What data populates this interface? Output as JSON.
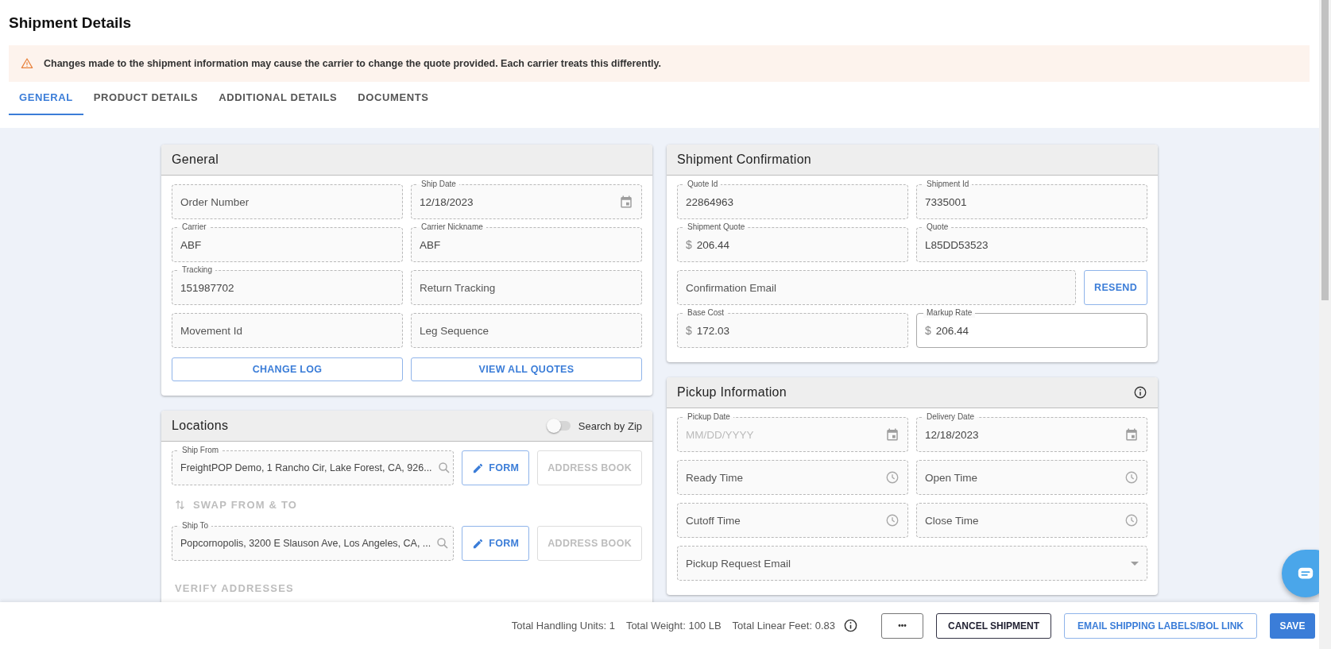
{
  "page": {
    "title": "Shipment Details"
  },
  "alert": {
    "text": "Changes made to the shipment information may cause the carrier to change the quote provided. Each carrier treats this differently."
  },
  "tabs": [
    {
      "label": "GENERAL",
      "selected": true
    },
    {
      "label": "PRODUCT DETAILS",
      "selected": false
    },
    {
      "label": "ADDITIONAL DETAILS",
      "selected": false
    },
    {
      "label": "DOCUMENTS",
      "selected": false
    }
  ],
  "general": {
    "title": "General",
    "rows": [
      [
        {
          "kind": "field",
          "placeholder": "Order Number",
          "disabled": true
        },
        {
          "kind": "date",
          "label": "Ship Date",
          "value": "12/18/2023",
          "disabled": true
        }
      ],
      [
        {
          "kind": "field",
          "label": "Carrier",
          "value": "ABF",
          "disabled": true
        },
        {
          "kind": "field",
          "label": "Carrier Nickname",
          "value": "ABF",
          "disabled": true
        }
      ],
      [
        {
          "kind": "field",
          "label": "Tracking",
          "value": " 151987702",
          "disabled": true
        },
        {
          "kind": "field",
          "placeholder": "Return Tracking",
          "disabled": true
        }
      ],
      [
        {
          "kind": "field",
          "placeholder": "Movement Id",
          "disabled": true
        },
        {
          "kind": "field",
          "placeholder": "Leg Sequence",
          "disabled": true
        }
      ],
      [
        {
          "kind": "button",
          "label": "CHANGE LOG",
          "disabled": false
        },
        {
          "kind": "button",
          "label": "VIEW ALL QUOTES",
          "disabled": false
        }
      ]
    ]
  },
  "locations": {
    "title": "Locations",
    "search_by_zip": {
      "label": "Search by Zip",
      "on": false
    },
    "rows": [
      [
        {
          "kind": "search",
          "label": "Ship From",
          "value": "FreightPOP Demo, 1 Rancho Cir, Lake Forest, CA, 926...",
          "disabled": true
        },
        {
          "kind": "edit_button",
          "label": "FORM",
          "disabled": false
        },
        {
          "kind": "button",
          "label": "ADDRESS BOOK",
          "disabled": true
        }
      ],
      [
        {
          "kind": "swap_link",
          "label": "SWAP FROM & TO",
          "disabled": true
        }
      ],
      [
        {
          "kind": "search",
          "label": "Ship To",
          "value": "Popcornopolis, 3200 E Slauson Ave, Los Angeles, CA, ...",
          "disabled": true
        },
        {
          "kind": "edit_button",
          "label": "FORM",
          "disabled": false
        },
        {
          "kind": "button",
          "label": "ADDRESS BOOK",
          "disabled": true
        }
      ],
      [
        {
          "kind": "link",
          "label": "VERIFY ADDRESSES",
          "disabled": true
        }
      ]
    ]
  },
  "confirmation": {
    "title": "Shipment Confirmation",
    "rows": [
      [
        {
          "kind": "field",
          "label": "Quote Id",
          "value": "22864963",
          "disabled": true
        },
        {
          "kind": "field",
          "label": "Shipment Id",
          "value": "7335001",
          "disabled": true
        }
      ],
      [
        {
          "kind": "field",
          "label": "Shipment Quote",
          "prefix": "$",
          "value": "206.44",
          "disabled": true
        },
        {
          "kind": "field",
          "label": "Quote",
          "value": "L85DD53523",
          "disabled": true
        }
      ],
      [
        {
          "kind": "field",
          "placeholder": "Confirmation Email",
          "disabled": true
        },
        {
          "kind": "button",
          "label": "RESEND",
          "disabled": false
        }
      ],
      [
        {
          "kind": "field",
          "label": "Base Cost",
          "prefix": "$",
          "value": "172.03",
          "disabled": true
        },
        {
          "kind": "field",
          "label": "Markup Rate",
          "prefix": "$",
          "value": "206.44",
          "disabled": false
        }
      ]
    ]
  },
  "pickup": {
    "title": "Pickup Information",
    "rows": [
      [
        {
          "kind": "date",
          "label": "Pickup Date",
          "placeholder": "MM/DD/YYYY",
          "disabled": true
        },
        {
          "kind": "date",
          "label": "Delivery Date",
          "value": "12/18/2023",
          "disabled": true
        }
      ],
      [
        {
          "kind": "time",
          "placeholder": "Ready Time",
          "disabled": true
        },
        {
          "kind": "time",
          "placeholder": "Open Time",
          "disabled": true
        }
      ],
      [
        {
          "kind": "time",
          "placeholder": "Cutoff Time",
          "disabled": true
        },
        {
          "kind": "time",
          "placeholder": "Close Time",
          "disabled": true
        }
      ],
      [
        {
          "kind": "select",
          "placeholder": "Pickup Request Email",
          "disabled": true
        }
      ]
    ]
  },
  "footer": {
    "totals": [
      "Total Handling Units: 1",
      "Total Weight: 100 LB",
      "Total Linear Feet: 0.83"
    ],
    "buttons": [
      {
        "kind": "more",
        "label": "•••"
      },
      {
        "kind": "dark",
        "label": "CANCEL SHIPMENT"
      },
      {
        "kind": "outline",
        "label": "EMAIL SHIPPING LABELS/BOL LINK"
      },
      {
        "kind": "primary",
        "label": "SAVE"
      }
    ]
  }
}
